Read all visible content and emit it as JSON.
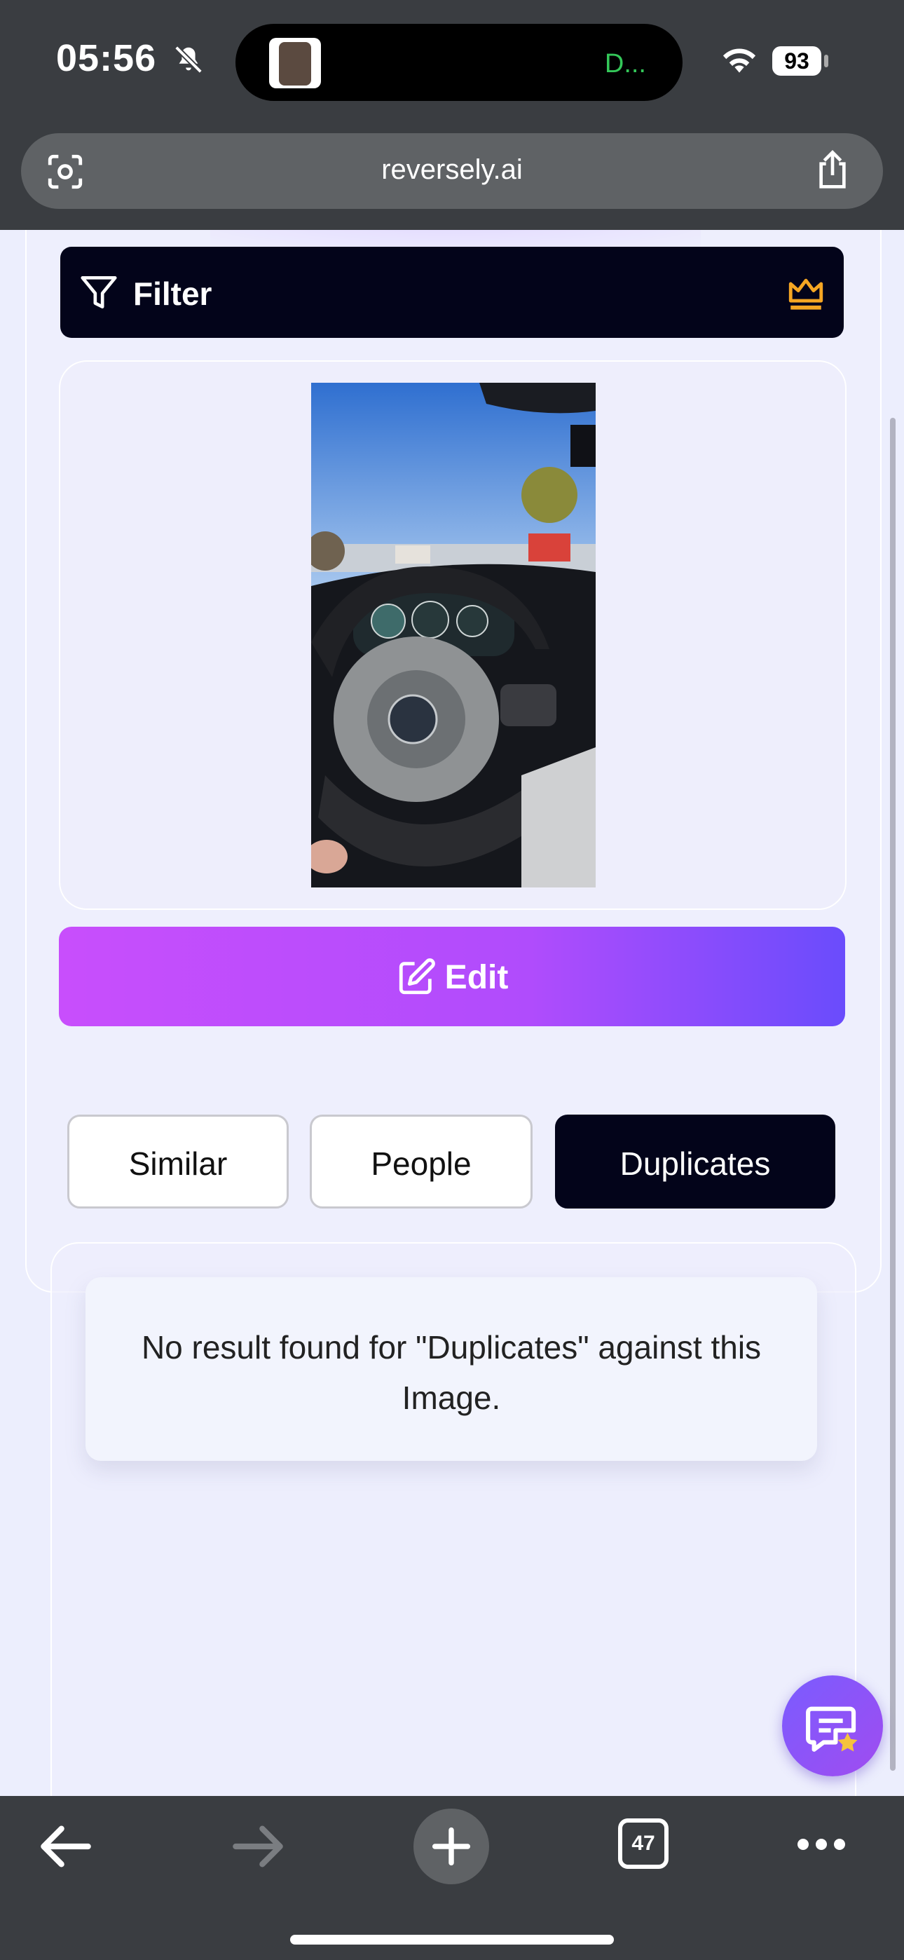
{
  "status": {
    "time": "05:56",
    "activity_text": "D...",
    "battery": "93"
  },
  "browser": {
    "url": "reversely.ai",
    "tabs_count": "47"
  },
  "filter": {
    "label": "Filter"
  },
  "edit": {
    "label": "Edit"
  },
  "tabs": [
    {
      "label": "Similar",
      "active": false
    },
    {
      "label": "People",
      "active": false
    },
    {
      "label": "Duplicates",
      "active": true
    }
  ],
  "result": {
    "message": "No result found for \"Duplicates\" against this Image."
  },
  "colors": {
    "accent_start": "#c84efc",
    "accent_end": "#6a4cfc",
    "dark": "#03041a",
    "crown": "#f5a623",
    "activity": "#34c759"
  }
}
